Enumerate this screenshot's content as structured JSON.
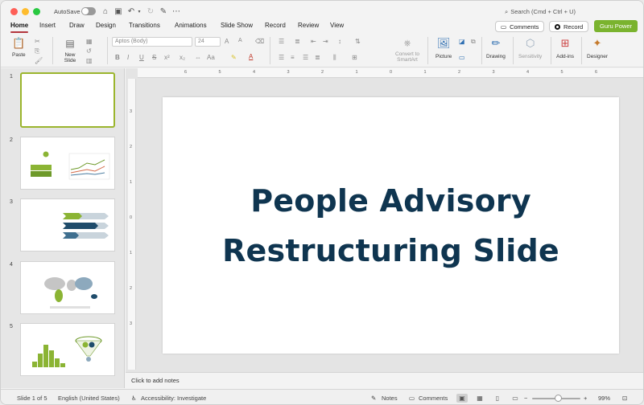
{
  "titlebar": {
    "autosave_label": "AutoSave",
    "search_placeholder": "Search (Cmd + Ctrl + U)"
  },
  "tabs": [
    "Home",
    "Insert",
    "Draw",
    "Design",
    "Transitions",
    "Animations",
    "Slide Show",
    "Record",
    "Review",
    "View"
  ],
  "top_buttons": {
    "comments": "Comments",
    "record": "Record",
    "guru": "Guru Power"
  },
  "ribbon": {
    "paste": "Paste",
    "new_slide_1": "New",
    "new_slide_2": "Slide",
    "font_name": "Aptos (Body)",
    "font_size": "24",
    "convert_1": "Convert to",
    "convert_2": "SmartArt",
    "picture": "Picture",
    "drawing": "Drawing",
    "sensitivity": "Sensitivity",
    "addins": "Add-ins",
    "designer": "Designer",
    "bold": "B",
    "italic": "I",
    "underline": "U",
    "strike": "S",
    "superscript": "x²",
    "subscript": "x₂",
    "aa": "Aa",
    "font_grow": "A",
    "font_shrink": "A"
  },
  "thumbnails": [
    {
      "num": "1",
      "selected": true
    },
    {
      "num": "2",
      "selected": false
    },
    {
      "num": "3",
      "selected": false
    },
    {
      "num": "4",
      "selected": false
    },
    {
      "num": "5",
      "selected": false
    }
  ],
  "ruler": {
    "h": [
      "6",
      "5",
      "4",
      "3",
      "2",
      "1",
      "0",
      "1",
      "2",
      "3",
      "4",
      "5",
      "6"
    ],
    "v": [
      "3",
      "2",
      "1",
      "0",
      "1",
      "2",
      "3"
    ]
  },
  "slide": {
    "line1": "People Advisory",
    "line2": "Restructuring Slide"
  },
  "notes_placeholder": "Click to add notes",
  "status": {
    "slide_of": "Slide 1 of 5",
    "language": "English (United States)",
    "accessibility": "Accessibility: Investigate",
    "notes": "Notes",
    "comments": "Comments",
    "zoom": "99%"
  },
  "colors": {
    "accent_green": "#7ab32e",
    "title_navy": "#0f3550",
    "active_tab_underline": "#b3363c"
  }
}
